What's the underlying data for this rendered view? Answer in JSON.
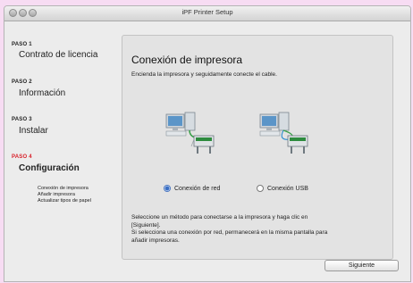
{
  "window": {
    "title": "iPF Printer Setup"
  },
  "sidebar": {
    "steps": [
      {
        "num": "PASO 1",
        "name": "Contrato de licencia"
      },
      {
        "num": "PASO 2",
        "name": "Información"
      },
      {
        "num": "PASO 3",
        "name": "Instalar"
      },
      {
        "num": "PASO 4",
        "name": "Configuración"
      }
    ],
    "substeps": [
      "Conexión de impresora",
      "Añadir impresora",
      "Actualizar tipos de papel"
    ]
  },
  "panel": {
    "title": "Conexión de impresora",
    "subtitle": "Encienda la impresora y seguidamente conecte el cable.",
    "options": [
      {
        "label": "Conexión de red",
        "selected": true
      },
      {
        "label": "Conexión USB",
        "selected": false
      }
    ],
    "description": [
      "Seleccione un método para conectarse a la impresora y haga clic en",
      "[Siguiente].",
      "Si selecciona una conexión por red, permanecerá en la misma pantalla para",
      "añadir impresoras."
    ]
  },
  "footer": {
    "next_label": "Siguiente"
  },
  "colors": {
    "active_step": "#d81e28",
    "background": "#f7dcf3",
    "window": "#ececec"
  }
}
